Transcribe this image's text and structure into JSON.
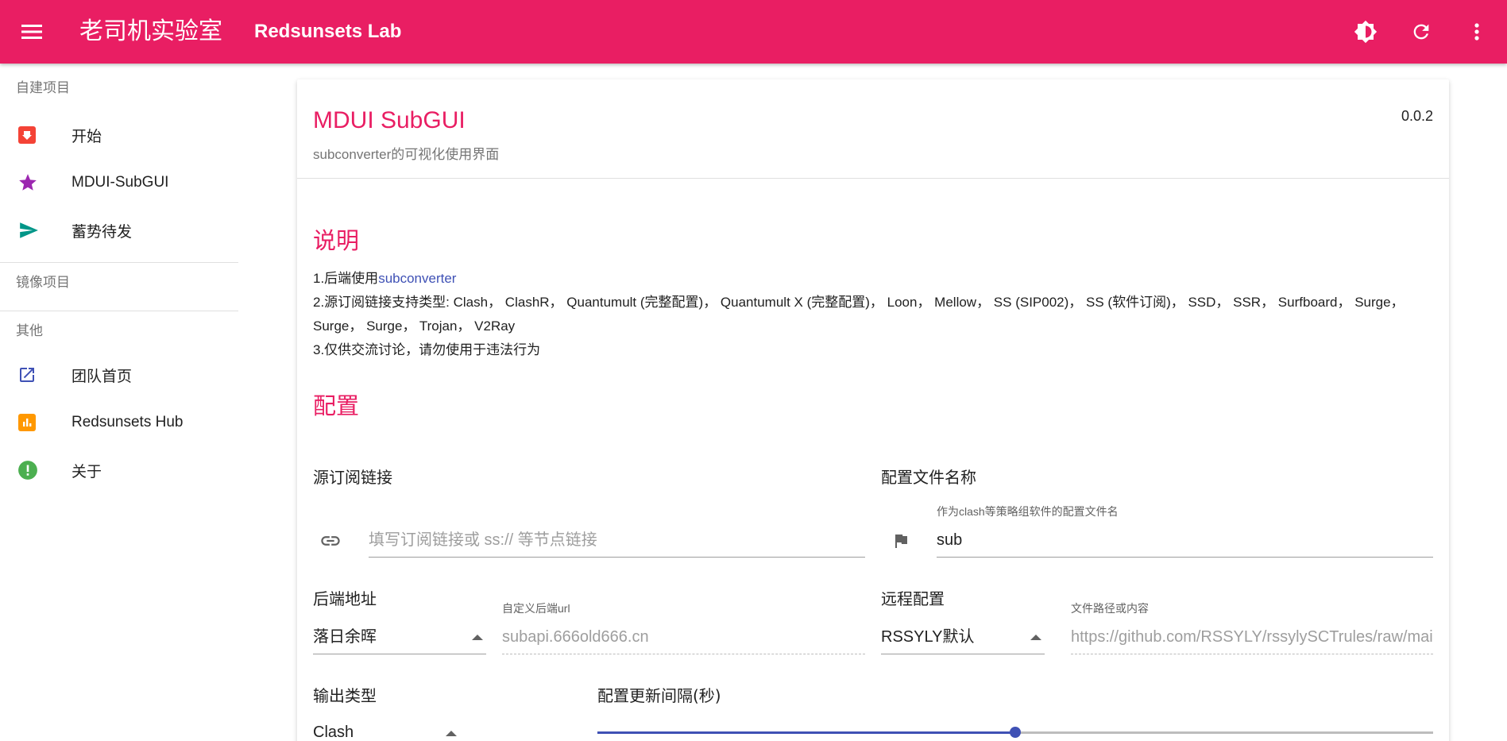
{
  "appbar": {
    "brand": "老司机实验室",
    "subtitle": "Redsunsets Lab",
    "actions": [
      "brightness-icon",
      "refresh-icon",
      "more-vert-icon"
    ]
  },
  "drawer": {
    "section1": "自建项目",
    "items1": [
      {
        "label": "开始",
        "icon": "start-icon",
        "color": "#f44336"
      },
      {
        "label": "MDUI-SubGUI",
        "icon": "star-icon",
        "color": "#9c27b0"
      },
      {
        "label": "蓄势待发",
        "icon": "send-icon",
        "color": "#009688"
      }
    ],
    "section2": "镜像项目",
    "section3": "其他",
    "items3": [
      {
        "label": "团队首页",
        "icon": "open-in-new-icon",
        "color": "#3f51b5"
      },
      {
        "label": "Redsunsets Hub",
        "icon": "chart-icon",
        "color": "#ff9800"
      },
      {
        "label": "关于",
        "icon": "info-icon",
        "color": "#4caf50"
      }
    ]
  },
  "card": {
    "title": "MDUI SubGUI",
    "subtitle": "subconverter的可视化使用界面",
    "version": "0.0.2",
    "desc_heading": "说明",
    "desc": {
      "line1_prefix": "1.后端使用",
      "line1_link": "subconverter",
      "line2": "2.源订阅链接支持类型: Clash， ClashR， Quantumult (完整配置)， Quantumult X (完整配置)， Loon， Mellow， SS (SIP002)， SS (软件订阅)， SSD， SSR， Surfboard， Surge， Surge， Surge， Trojan， V2Ray",
      "line3": "3.仅供交流讨论，请勿使用于违法行为"
    },
    "config_heading": "配置"
  },
  "form": {
    "source_label": "源订阅链接",
    "source_placeholder": "填写订阅链接或 ss:// 等节点链接",
    "filename_label": "配置文件名称",
    "filename_hint": "作为clash等策略组软件的配置文件名",
    "filename_value": "sub",
    "backend_label": "后端地址",
    "backend_value": "落日余晖",
    "custom_backend_hint": "自定义后端url",
    "custom_backend_placeholder": "subapi.666old666.cn",
    "remote_label": "远程配置",
    "remote_value": "RSSYLY默认",
    "remote_path_hint": "文件路径或内容",
    "remote_path_placeholder": "https://github.com/RSSYLY/rssylySCTrules/raw/main/RSSYLY.ini",
    "output_label": "输出类型",
    "output_value": "Clash",
    "interval_label": "配置更新间隔(秒)",
    "interval_fraction": 0.5
  },
  "colors": {
    "primary": "#e91e63",
    "accent": "#3f51b5"
  }
}
